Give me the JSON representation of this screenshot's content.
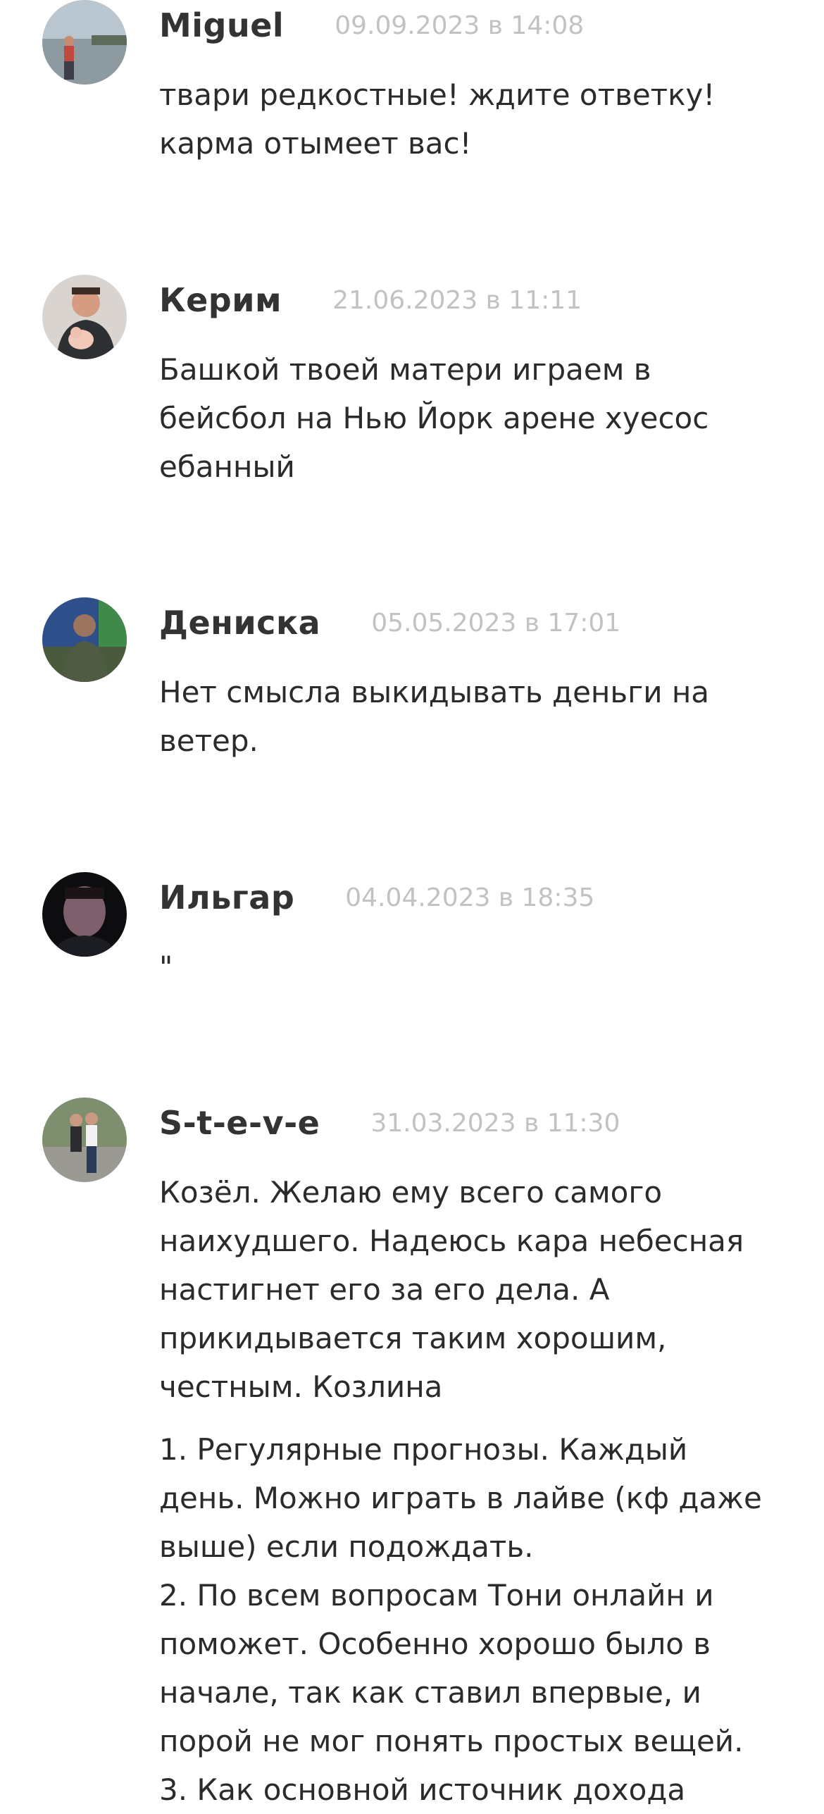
{
  "comments": [
    {
      "author": "Miguel",
      "date": "09.09.2023 в 14:08",
      "lines": [
        "твари редкостные! ждите ответку!",
        "карма отымеет вас!"
      ]
    },
    {
      "author": "Керим",
      "date": "21.06.2023 в 11:11",
      "lines": [
        "Башкой твоей матери играем в",
        "бейсбол на Нью Йорк арене хуесос",
        "ебанный"
      ]
    },
    {
      "author": "Дениска",
      "date": "05.05.2023 в 17:01",
      "lines": [
        "Нет смысла выкидывать деньги на",
        "ветер."
      ]
    },
    {
      "author": "Ильгар",
      "date": "04.04.2023 в 18:35",
      "lines": [
        "\""
      ]
    },
    {
      "author": "S-t-e-v-e",
      "date": "31.03.2023 в 11:30",
      "lines": [
        "Козёл. Желаю ему всего самого",
        "наихудшего. Надеюсь кара небесная",
        "настигнет его за его дела. А",
        "прикидывается таким хорошим,",
        "честным. Козлина"
      ],
      "lines2": [
        "1. Регулярные прогнозы. Каждый",
        "день. Можно играть в лайве (кф даже",
        "выше) если подождать.",
        "2. По всем вопросам Тони онлайн и",
        "поможет. Особенно хорошо было в",
        "начале, так как ставил впервые, и",
        "порой не мог понять простых вещей.",
        "3. Как основной источник дохода"
      ]
    }
  ]
}
